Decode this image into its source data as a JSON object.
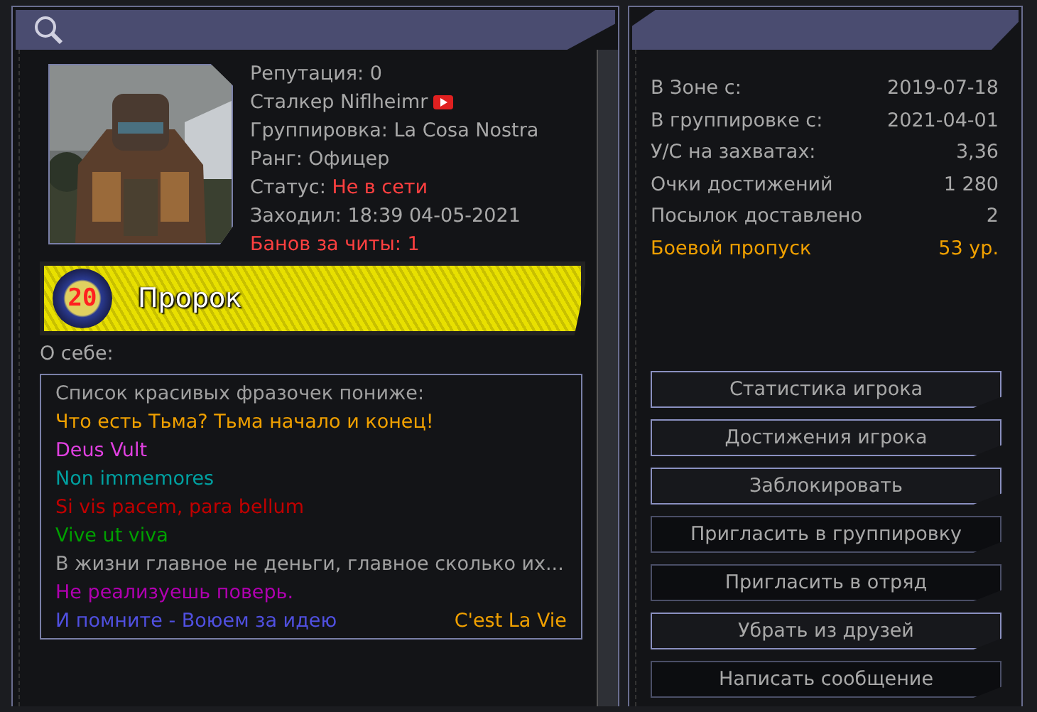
{
  "profile": {
    "lines": [
      {
        "kind": "plain",
        "label": "Репутация: 0"
      },
      {
        "kind": "channel",
        "label": "Сталкер Niflheimr"
      },
      {
        "kind": "plain",
        "label": "Группировка: La Cosa Nostra"
      },
      {
        "kind": "plain",
        "label": "Ранг: Офицер"
      },
      {
        "kind": "status",
        "label": "Статус:",
        "value": "Не в сети"
      },
      {
        "kind": "plain",
        "label": "Заходил: 18:39 04-05-2021"
      },
      {
        "kind": "warning",
        "label": "Банов за читы: 1"
      }
    ]
  },
  "rank_bar": {
    "level": "20",
    "title": "Пророк"
  },
  "about": {
    "label": "О себе:",
    "lines": [
      {
        "text": "Список красивых фразочек пониже:",
        "color": "#a0a0a0"
      },
      {
        "text": "Что есть Тьма? Тьма начало и конец!",
        "color": "#f0a000"
      },
      {
        "text": "Deus Vult",
        "color": "#e040e0"
      },
      {
        "text": "Non immemores",
        "color": "#00a0a0"
      },
      {
        "text": "Si vis pacem, para bellum",
        "color": "#c00000"
      },
      {
        "text": "Vive ut viva",
        "color": "#00a000"
      },
      {
        "text": "В жизни главное не деньги, главное сколько их...",
        "color": "#a0a0a0"
      },
      {
        "text": "Не реализуешь поверь.",
        "color": "#b000b0"
      },
      {
        "text": "И помните - Воюем за идею",
        "color": "#5050e0"
      }
    ],
    "signature": {
      "text": "C'est La Vie",
      "color": "#f0a000"
    }
  },
  "stats": [
    {
      "label": "В Зоне с:",
      "value": "2019-07-18",
      "highlighted": false
    },
    {
      "label": "В группировке с:",
      "value": "2021-04-01",
      "highlighted": false
    },
    {
      "label": "У/С на захватах:",
      "value": "3,36",
      "highlighted": false
    },
    {
      "label": "Очки достижений",
      "value": "1 280",
      "highlighted": false
    },
    {
      "label": "Посылок доставлено",
      "value": "2",
      "highlighted": false
    },
    {
      "label": "Боевой пропуск",
      "value": "53 ур.",
      "highlighted": true
    }
  ],
  "buttons": [
    {
      "label": "Статистика игрока",
      "disabled": false
    },
    {
      "label": "Достижения игрока",
      "disabled": false
    },
    {
      "label": "Заблокировать",
      "disabled": false
    },
    {
      "label": "Пригласить в группировку",
      "disabled": true
    },
    {
      "label": "Пригласить в отряд",
      "disabled": true
    },
    {
      "label": "Убрать из друзей",
      "disabled": false
    },
    {
      "label": "Написать сообщение",
      "disabled": true
    }
  ]
}
